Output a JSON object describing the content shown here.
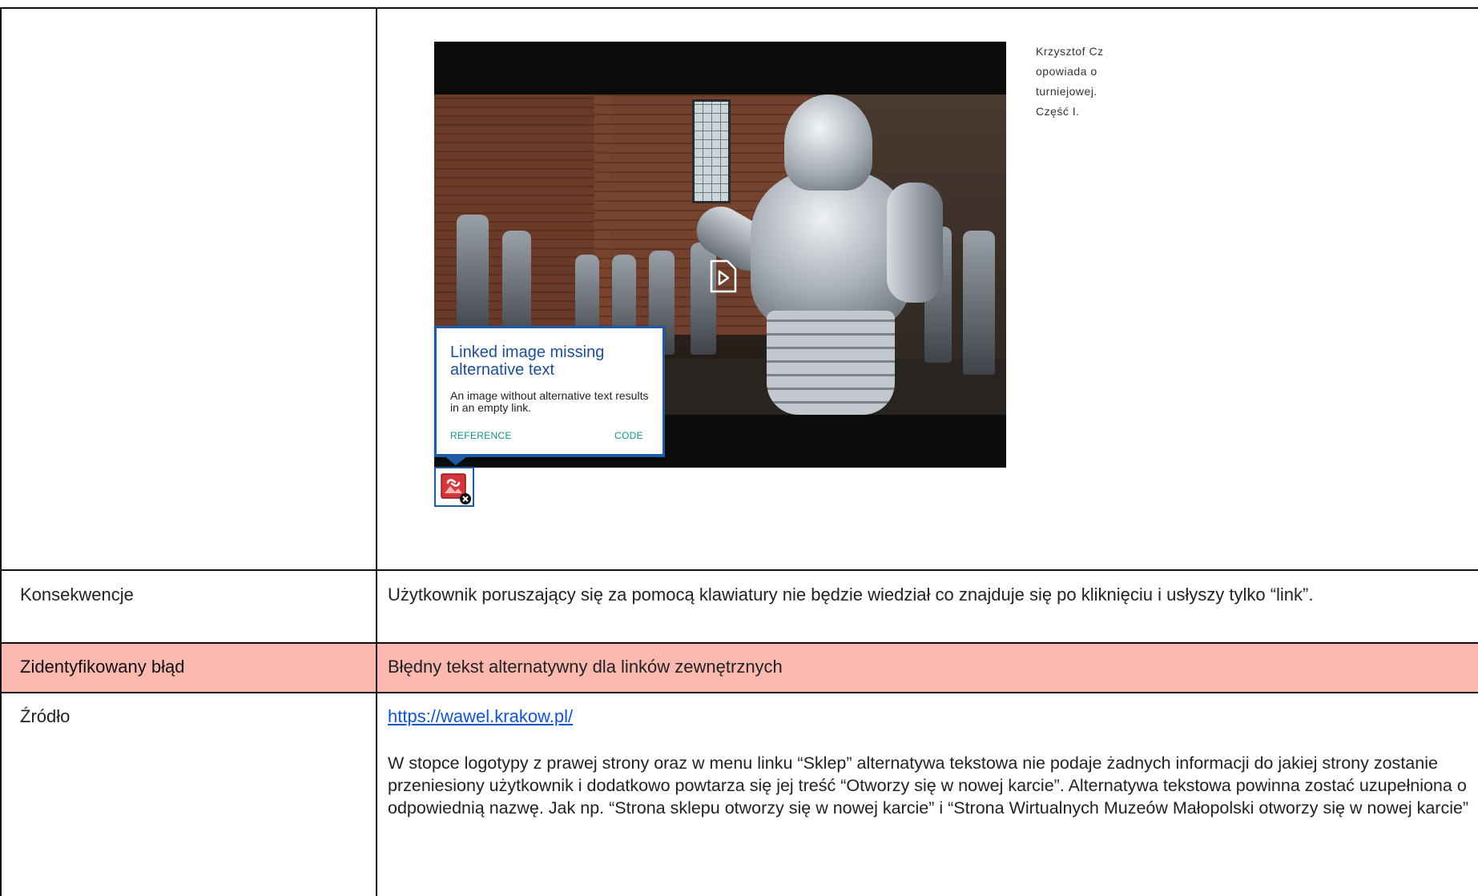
{
  "media": {
    "caption_lines": [
      "Krzysztof Cz",
      "opowiada o",
      "turniejowej.",
      "Część I."
    ],
    "popup": {
      "title": "Linked image missing alternative text",
      "description": "An image without alternative text results in an empty link.",
      "reference_label": "REFERENCE",
      "code_label": "CODE"
    }
  },
  "rows": {
    "consequences": {
      "label": "Konsekwencje",
      "text": "Użytkownik poruszający się za pomocą klawiatury nie będzie wiedział co znajduje się po kliknięciu i usłyszy tylko “link”."
    },
    "identified_error": {
      "label": "Zidentyfikowany błąd",
      "text": "Błędny tekst alternatywny dla linków zewnętrznych"
    },
    "source": {
      "label": "Źródło",
      "link": "https://wawel.krakow.pl/",
      "description": "W stopce logotypy z prawej strony oraz w menu linku “Sklep” alternatywa tekstowa nie podaje żadnych informacji do jakiej strony zostanie przeniesiony użytkownik i dodatkowo powtarza się jej treść “Otworzy się w nowej karcie”. Alternatywa tekstowa powinna zostać uzupełniona o odpowiednią nazwę. Jak np. “Strona sklepu otworzy się w nowej karcie” i “Strona Wirtualnych Muzeów Małopolski otworzy się w nowej karcie”"
    }
  },
  "colors": {
    "highlight_row": "#fdb8b0",
    "table_border": "#111111",
    "link": "#1155cc",
    "popup_accent": "#1f5aa8"
  }
}
